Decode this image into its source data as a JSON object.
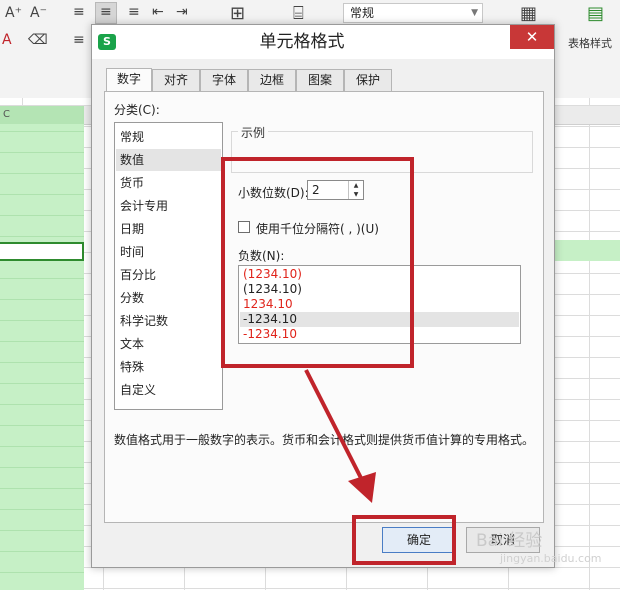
{
  "ribbon": {
    "number_format_value": "常规",
    "table_style_label": "表格样式"
  },
  "sheet": {
    "column_header": "C"
  },
  "dialog": {
    "title": "单元格格式",
    "app_icon_text": "S",
    "close_symbol": "✕",
    "tabs": [
      {
        "label": "数字",
        "active": true
      },
      {
        "label": "对齐",
        "active": false
      },
      {
        "label": "字体",
        "active": false
      },
      {
        "label": "边框",
        "active": false
      },
      {
        "label": "图案",
        "active": false
      },
      {
        "label": "保护",
        "active": false
      }
    ],
    "category_label": "分类(C):",
    "categories": [
      "常规",
      "数值",
      "货币",
      "会计专用",
      "日期",
      "时间",
      "百分比",
      "分数",
      "科学记数",
      "文本",
      "特殊",
      "自定义"
    ],
    "selected_category": "数值",
    "sample_label": "示例",
    "decimal_label": "小数位数(D):",
    "decimal_value": "2",
    "thousands_label": "使用千位分隔符( , )(U)",
    "thousands_checked": false,
    "negative_label": "负数(N):",
    "negative_options": [
      {
        "text": "(1234.10)",
        "color": "#e0241b"
      },
      {
        "text": "(1234.10)",
        "color": "#222222"
      },
      {
        "text": "1234.10",
        "color": "#e0241b"
      },
      {
        "text": "-1234.10",
        "color": "#222222"
      },
      {
        "text": "-1234.10",
        "color": "#e0241b"
      }
    ],
    "selected_negative_index": 3,
    "description": "数值格式用于一般数字的表示。货币和会计格式则提供货币值计算的专用格式。",
    "ok_label": "确定",
    "cancel_label": "取消"
  },
  "annotations": {
    "color": "#c0242b"
  },
  "watermark": {
    "main": "Bai 经验",
    "sub": "jingyan.baidu.com"
  }
}
